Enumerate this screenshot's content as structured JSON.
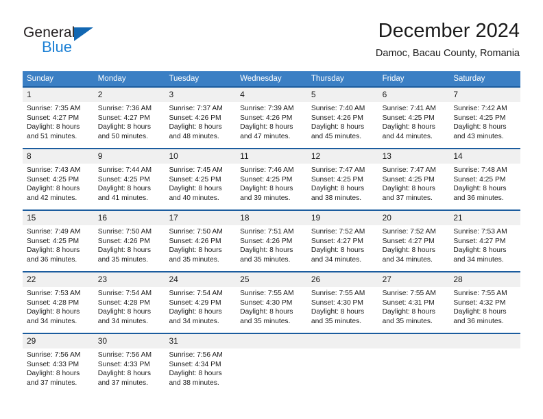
{
  "logo": {
    "text_top": "General",
    "text_bottom": "Blue",
    "triangle_icon": "triangle-icon",
    "brand_blue": "#1a7fd4",
    "triangle_blue": "#1267b2"
  },
  "header": {
    "title": "December 2024",
    "subtitle": "Damoc, Bacau County, Romania"
  },
  "calendar": {
    "header_bg": "#3b7fc4",
    "header_text_color": "#ffffff",
    "cell_top_border": "#1b5c9e",
    "daynum_bg": "#f0f0f0",
    "weekdays": [
      "Sunday",
      "Monday",
      "Tuesday",
      "Wednesday",
      "Thursday",
      "Friday",
      "Saturday"
    ],
    "weeks": [
      [
        {
          "day": "1",
          "sunrise": "Sunrise: 7:35 AM",
          "sunset": "Sunset: 4:27 PM",
          "daylight_line1": "Daylight: 8 hours",
          "daylight_line2": "and 51 minutes."
        },
        {
          "day": "2",
          "sunrise": "Sunrise: 7:36 AM",
          "sunset": "Sunset: 4:27 PM",
          "daylight_line1": "Daylight: 8 hours",
          "daylight_line2": "and 50 minutes."
        },
        {
          "day": "3",
          "sunrise": "Sunrise: 7:37 AM",
          "sunset": "Sunset: 4:26 PM",
          "daylight_line1": "Daylight: 8 hours",
          "daylight_line2": "and 48 minutes."
        },
        {
          "day": "4",
          "sunrise": "Sunrise: 7:39 AM",
          "sunset": "Sunset: 4:26 PM",
          "daylight_line1": "Daylight: 8 hours",
          "daylight_line2": "and 47 minutes."
        },
        {
          "day": "5",
          "sunrise": "Sunrise: 7:40 AM",
          "sunset": "Sunset: 4:26 PM",
          "daylight_line1": "Daylight: 8 hours",
          "daylight_line2": "and 45 minutes."
        },
        {
          "day": "6",
          "sunrise": "Sunrise: 7:41 AM",
          "sunset": "Sunset: 4:25 PM",
          "daylight_line1": "Daylight: 8 hours",
          "daylight_line2": "and 44 minutes."
        },
        {
          "day": "7",
          "sunrise": "Sunrise: 7:42 AM",
          "sunset": "Sunset: 4:25 PM",
          "daylight_line1": "Daylight: 8 hours",
          "daylight_line2": "and 43 minutes."
        }
      ],
      [
        {
          "day": "8",
          "sunrise": "Sunrise: 7:43 AM",
          "sunset": "Sunset: 4:25 PM",
          "daylight_line1": "Daylight: 8 hours",
          "daylight_line2": "and 42 minutes."
        },
        {
          "day": "9",
          "sunrise": "Sunrise: 7:44 AM",
          "sunset": "Sunset: 4:25 PM",
          "daylight_line1": "Daylight: 8 hours",
          "daylight_line2": "and 41 minutes."
        },
        {
          "day": "10",
          "sunrise": "Sunrise: 7:45 AM",
          "sunset": "Sunset: 4:25 PM",
          "daylight_line1": "Daylight: 8 hours",
          "daylight_line2": "and 40 minutes."
        },
        {
          "day": "11",
          "sunrise": "Sunrise: 7:46 AM",
          "sunset": "Sunset: 4:25 PM",
          "daylight_line1": "Daylight: 8 hours",
          "daylight_line2": "and 39 minutes."
        },
        {
          "day": "12",
          "sunrise": "Sunrise: 7:47 AM",
          "sunset": "Sunset: 4:25 PM",
          "daylight_line1": "Daylight: 8 hours",
          "daylight_line2": "and 38 minutes."
        },
        {
          "day": "13",
          "sunrise": "Sunrise: 7:47 AM",
          "sunset": "Sunset: 4:25 PM",
          "daylight_line1": "Daylight: 8 hours",
          "daylight_line2": "and 37 minutes."
        },
        {
          "day": "14",
          "sunrise": "Sunrise: 7:48 AM",
          "sunset": "Sunset: 4:25 PM",
          "daylight_line1": "Daylight: 8 hours",
          "daylight_line2": "and 36 minutes."
        }
      ],
      [
        {
          "day": "15",
          "sunrise": "Sunrise: 7:49 AM",
          "sunset": "Sunset: 4:25 PM",
          "daylight_line1": "Daylight: 8 hours",
          "daylight_line2": "and 36 minutes."
        },
        {
          "day": "16",
          "sunrise": "Sunrise: 7:50 AM",
          "sunset": "Sunset: 4:26 PM",
          "daylight_line1": "Daylight: 8 hours",
          "daylight_line2": "and 35 minutes."
        },
        {
          "day": "17",
          "sunrise": "Sunrise: 7:50 AM",
          "sunset": "Sunset: 4:26 PM",
          "daylight_line1": "Daylight: 8 hours",
          "daylight_line2": "and 35 minutes."
        },
        {
          "day": "18",
          "sunrise": "Sunrise: 7:51 AM",
          "sunset": "Sunset: 4:26 PM",
          "daylight_line1": "Daylight: 8 hours",
          "daylight_line2": "and 35 minutes."
        },
        {
          "day": "19",
          "sunrise": "Sunrise: 7:52 AM",
          "sunset": "Sunset: 4:27 PM",
          "daylight_line1": "Daylight: 8 hours",
          "daylight_line2": "and 34 minutes."
        },
        {
          "day": "20",
          "sunrise": "Sunrise: 7:52 AM",
          "sunset": "Sunset: 4:27 PM",
          "daylight_line1": "Daylight: 8 hours",
          "daylight_line2": "and 34 minutes."
        },
        {
          "day": "21",
          "sunrise": "Sunrise: 7:53 AM",
          "sunset": "Sunset: 4:27 PM",
          "daylight_line1": "Daylight: 8 hours",
          "daylight_line2": "and 34 minutes."
        }
      ],
      [
        {
          "day": "22",
          "sunrise": "Sunrise: 7:53 AM",
          "sunset": "Sunset: 4:28 PM",
          "daylight_line1": "Daylight: 8 hours",
          "daylight_line2": "and 34 minutes."
        },
        {
          "day": "23",
          "sunrise": "Sunrise: 7:54 AM",
          "sunset": "Sunset: 4:28 PM",
          "daylight_line1": "Daylight: 8 hours",
          "daylight_line2": "and 34 minutes."
        },
        {
          "day": "24",
          "sunrise": "Sunrise: 7:54 AM",
          "sunset": "Sunset: 4:29 PM",
          "daylight_line1": "Daylight: 8 hours",
          "daylight_line2": "and 34 minutes."
        },
        {
          "day": "25",
          "sunrise": "Sunrise: 7:55 AM",
          "sunset": "Sunset: 4:30 PM",
          "daylight_line1": "Daylight: 8 hours",
          "daylight_line2": "and 35 minutes."
        },
        {
          "day": "26",
          "sunrise": "Sunrise: 7:55 AM",
          "sunset": "Sunset: 4:30 PM",
          "daylight_line1": "Daylight: 8 hours",
          "daylight_line2": "and 35 minutes."
        },
        {
          "day": "27",
          "sunrise": "Sunrise: 7:55 AM",
          "sunset": "Sunset: 4:31 PM",
          "daylight_line1": "Daylight: 8 hours",
          "daylight_line2": "and 35 minutes."
        },
        {
          "day": "28",
          "sunrise": "Sunrise: 7:55 AM",
          "sunset": "Sunset: 4:32 PM",
          "daylight_line1": "Daylight: 8 hours",
          "daylight_line2": "and 36 minutes."
        }
      ],
      [
        {
          "day": "29",
          "sunrise": "Sunrise: 7:56 AM",
          "sunset": "Sunset: 4:33 PM",
          "daylight_line1": "Daylight: 8 hours",
          "daylight_line2": "and 37 minutes."
        },
        {
          "day": "30",
          "sunrise": "Sunrise: 7:56 AM",
          "sunset": "Sunset: 4:33 PM",
          "daylight_line1": "Daylight: 8 hours",
          "daylight_line2": "and 37 minutes."
        },
        {
          "day": "31",
          "sunrise": "Sunrise: 7:56 AM",
          "sunset": "Sunset: 4:34 PM",
          "daylight_line1": "Daylight: 8 hours",
          "daylight_line2": "and 38 minutes."
        },
        {
          "day": "",
          "sunrise": "",
          "sunset": "",
          "daylight_line1": "",
          "daylight_line2": ""
        },
        {
          "day": "",
          "sunrise": "",
          "sunset": "",
          "daylight_line1": "",
          "daylight_line2": ""
        },
        {
          "day": "",
          "sunrise": "",
          "sunset": "",
          "daylight_line1": "",
          "daylight_line2": ""
        },
        {
          "day": "",
          "sunrise": "",
          "sunset": "",
          "daylight_line1": "",
          "daylight_line2": ""
        }
      ]
    ]
  }
}
